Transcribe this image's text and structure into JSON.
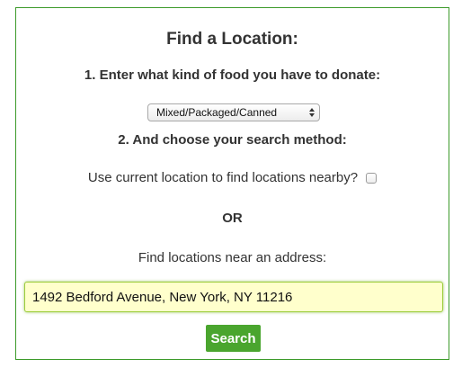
{
  "form": {
    "title": "Find a Location:",
    "step1_label": "1. Enter what kind of food you have to donate:",
    "food_type": {
      "selected": "Mixed/Packaged/Canned",
      "icon": "select-updown-arrows-icon"
    },
    "step2_label": "2. And choose your search method:",
    "current_location_label": "Use current location to find locations nearby?",
    "current_location_checked": false,
    "or_label": "OR",
    "address_label": "Find locations near an address:",
    "address_value": "1492 Bedford Avenue, New York, NY 11216",
    "search_label": "Search"
  },
  "colors": {
    "panel_border": "#3c9a2a",
    "button_bg": "#4aa52e",
    "input_bg": "#ffffcc",
    "input_border": "#9ccc3c"
  }
}
